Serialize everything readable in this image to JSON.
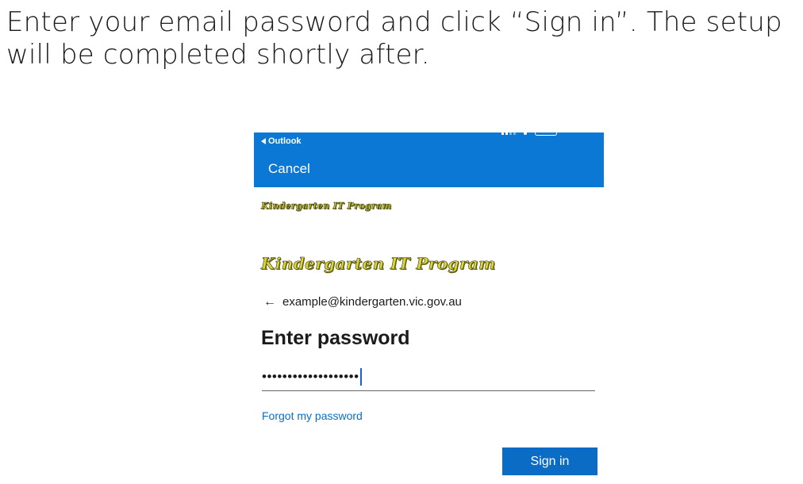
{
  "instruction": {
    "text": "Enter your email password and click “Sign in”. The setup will be completed shortly after."
  },
  "status_bar": {
    "back_app_label": "Outlook"
  },
  "header": {
    "cancel_label": "Cancel",
    "background_color": "#0a78d4"
  },
  "brand": {
    "logo_small_text": "Kindergarten IT Program",
    "logo_large_text": "Kindergarten IT Program"
  },
  "identity": {
    "email": "example@kindergarten.vic.gov.au"
  },
  "form": {
    "heading": "Enter password",
    "password_masked": "•••••••••••••••••••",
    "forgot_link": "Forgot my password",
    "submit_label": "Sign in",
    "accent_color": "#0a6cc4"
  }
}
